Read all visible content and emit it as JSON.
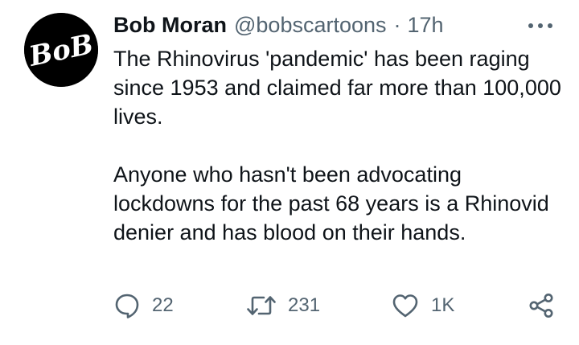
{
  "tweet": {
    "author": {
      "name": "Bob Moran",
      "handle": "@bobscartoons",
      "avatar_icon": "bob-logo-avatar",
      "avatar_text": "BoB"
    },
    "separator": "·",
    "timestamp": "17h",
    "more_icon": "more-horizontal-icon",
    "text": {
      "paragraph_1": "The Rhinovirus 'pandemic' has been raging since 1953 and claimed far more than 100,000 lives.",
      "paragraph_2": "Anyone who hasn't been advocating lockdowns for the past 68 years is a Rhinovid denier and has blood on their hands."
    },
    "actions": {
      "reply": {
        "icon": "reply-icon",
        "count": "22"
      },
      "retweet": {
        "icon": "retweet-icon",
        "count": "231"
      },
      "like": {
        "icon": "heart-icon",
        "count": "1K"
      },
      "share": {
        "icon": "share-icon"
      }
    }
  },
  "colors": {
    "text_primary": "#0f1419",
    "text_secondary": "#536471",
    "background": "#ffffff",
    "avatar_bg": "#000000"
  }
}
